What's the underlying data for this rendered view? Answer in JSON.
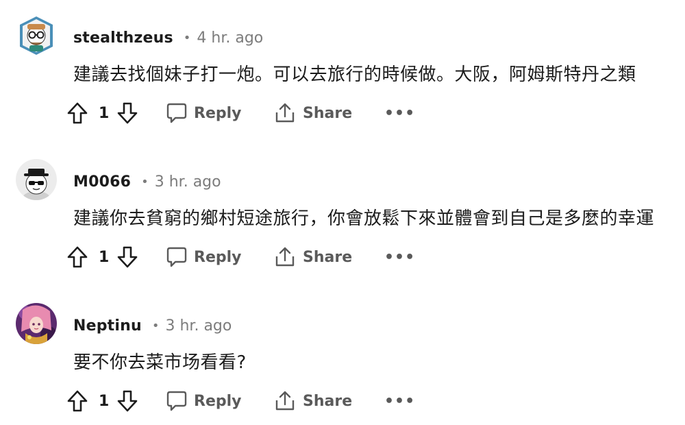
{
  "comments": [
    {
      "username": "stealthzeus",
      "separator": "•",
      "time": "4 hr. ago",
      "text": "建議去找個妹子打一炮。可以去旅行的時候做。大阪，阿姆斯特丹之類",
      "votes": "1",
      "reply_label": "Reply",
      "share_label": "Share",
      "more_label": "•••"
    },
    {
      "username": "M0066",
      "separator": "•",
      "time": "3 hr. ago",
      "text": "建議你去貧窮的鄉村短途旅行，你會放鬆下來並體會到自己是多麼的幸運",
      "votes": "1",
      "reply_label": "Reply",
      "share_label": "Share",
      "more_label": "•••"
    },
    {
      "username": "Neptinu",
      "separator": "•",
      "time": "3 hr. ago",
      "text": "要不你去菜市场看看?",
      "votes": "1",
      "reply_label": "Reply",
      "share_label": "Share",
      "more_label": "•••"
    }
  ],
  "icons": {
    "upvote": "upvote-arrow-icon",
    "downvote": "downvote-arrow-icon",
    "reply": "speech-bubble-icon",
    "share": "share-arrow-icon",
    "more": "ellipsis-icon"
  },
  "colors": {
    "text": "#1c1c1c",
    "meta": "#7c7c7c",
    "action": "#5a5a5a",
    "avatar_bg_1": "#4a8fb8",
    "avatar_bg_2": "#ececec",
    "avatar_bg_3": "#5b2a6e"
  }
}
